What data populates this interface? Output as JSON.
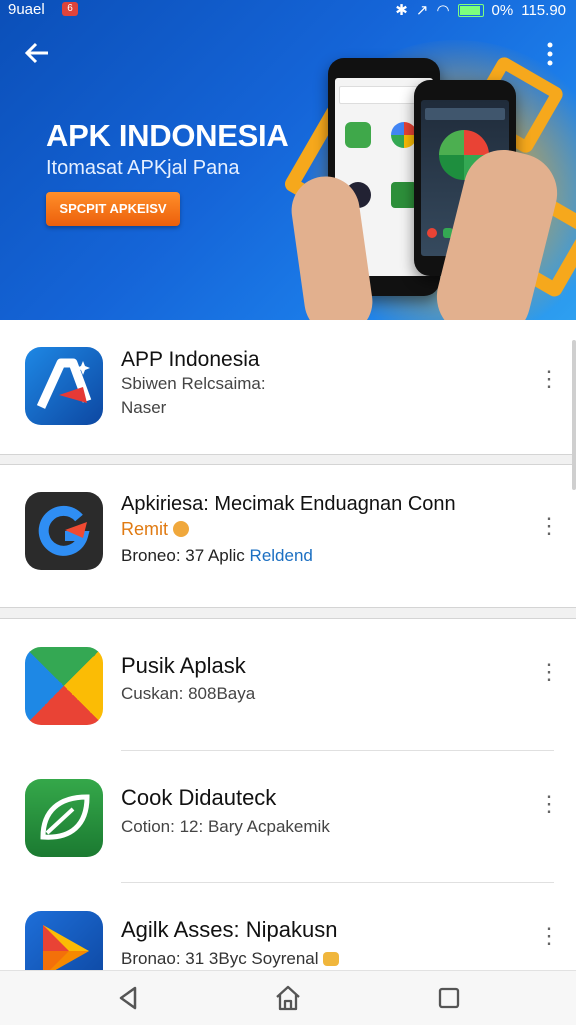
{
  "status": {
    "carrier": "9uael",
    "notif": "6",
    "time": "115.90",
    "battery_text": "0%",
    "battery_level": 0.85
  },
  "header": {
    "title": "APK INDONESIA",
    "subtitle": "Itomasat APKjal Pana",
    "cta": "SPCPIT APKEISV"
  },
  "apps": [
    {
      "title": "APP Indonesia",
      "line1": "Sbiwen Relcsaima:",
      "line2": "Naser"
    },
    {
      "title": "Apkiriesa: Mecimak Enduagnan Conn",
      "line1": "Remit",
      "line2_prefix": "Broneo: 37 Aplic",
      "line2_link": "Reldend"
    },
    {
      "title": "Pusik Aplask",
      "line1": "Cuskan: 808Baya"
    },
    {
      "title": "Cook Didauteck",
      "line1": "Cotion: 12: Bary Acpakemik"
    },
    {
      "title": "Agilk Asses: Nipakusn",
      "line1": "Bronao: 31 3Byc Soyrenal"
    }
  ],
  "colors": {
    "hero": "#1565d8",
    "accent_orange": "#ec5f0b",
    "link": "#1b6fc2"
  }
}
